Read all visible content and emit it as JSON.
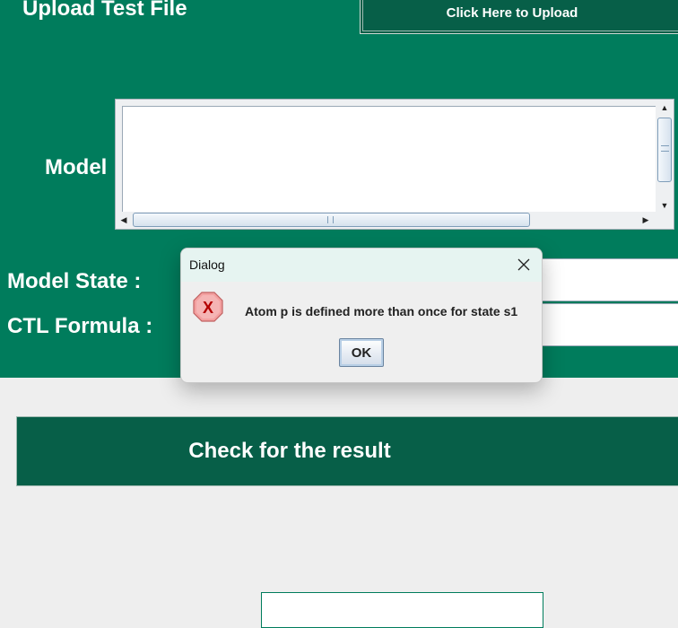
{
  "upload": {
    "title": "Upload Test File",
    "button_label": "Click Here to Upload"
  },
  "labels": {
    "model": "Model",
    "model_state": "Model State :",
    "ctl_formula": "CTL Formula :"
  },
  "model_scroll": {
    "vertical_thumb_level": 0.0,
    "horizontal_thumb_level": 0.0
  },
  "check_button": {
    "label": "Check for the result"
  },
  "dialog": {
    "title": "Dialog",
    "close_icon": "close-icon",
    "error_icon": "error-icon",
    "message": "Atom p is defined more than once for state s1",
    "ok_label": "OK"
  },
  "colors": {
    "panel": "#007c5c",
    "button_dark": "#075f48",
    "background": "#eeeeee"
  }
}
